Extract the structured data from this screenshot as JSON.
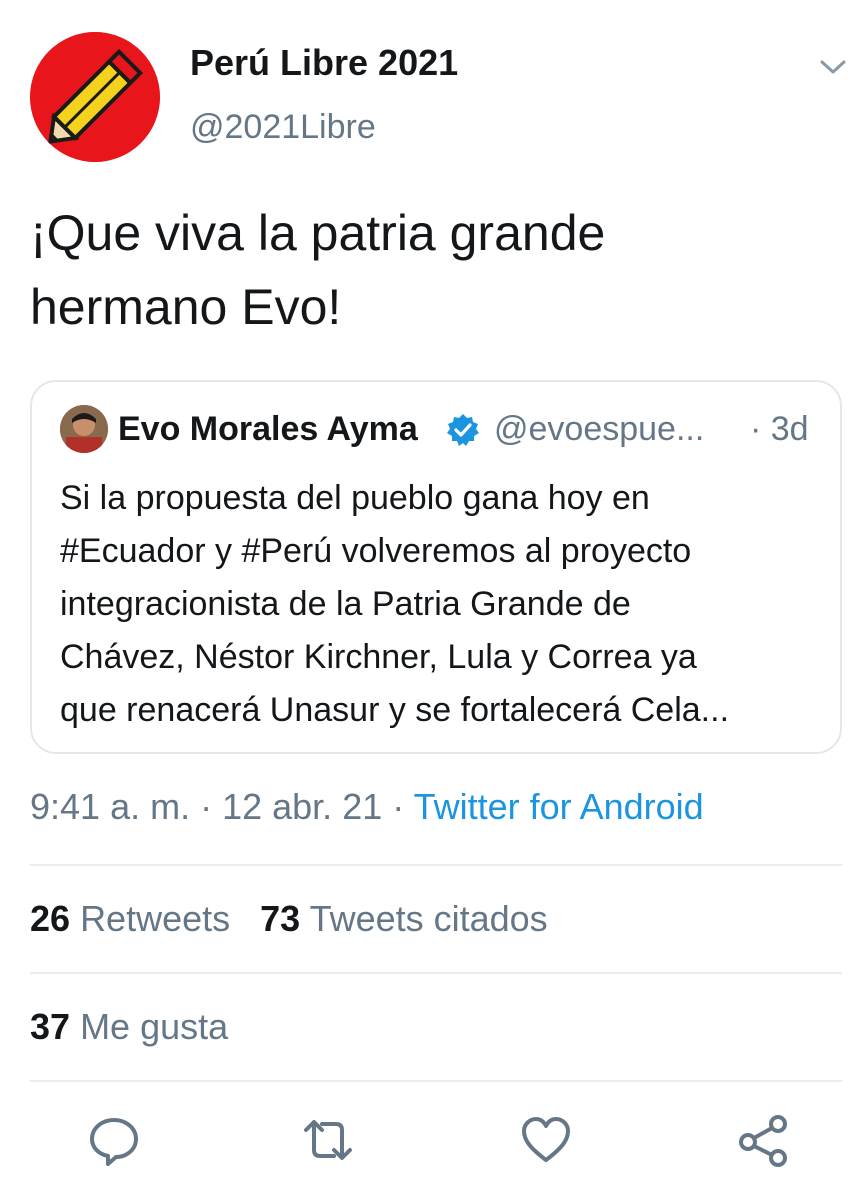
{
  "header": {
    "display_name": "Perú Libre 2021",
    "handle": "@2021Libre"
  },
  "tweet": {
    "text_lines": [
      "¡Que viva la patria grande",
      "hermano Evo!"
    ]
  },
  "quoted_tweet": {
    "name": "Evo Morales Ayma",
    "handle": "@evoespue...",
    "time": "· 3d",
    "text_lines": [
      "Si la propuesta del pueblo gana hoy en",
      "#Ecuador y #Perú volveremos al proyecto",
      "integracionista de la Patria Grande de",
      "Chávez, Néstor Kirchner, Lula y Correa ya",
      "que renacerá Unasur y se fortalecerá Cela..."
    ]
  },
  "meta": {
    "time": "9:41 a. m.",
    "sep1": " · ",
    "date": "12 abr. 21",
    "sep2": " · ",
    "source": "Twitter for Android"
  },
  "stats": {
    "retweets_count": "26",
    "retweets_label": "Retweets",
    "quotes_count": "73",
    "quotes_label": "Tweets citados",
    "likes_count": "37",
    "likes_label": "Me gusta"
  },
  "icons": {
    "caret": "chevron-down-icon",
    "reply": "reply-icon",
    "retweet": "retweet-icon",
    "like": "heart-icon",
    "share": "share-icon",
    "verified": "verified-badge-icon"
  },
  "colors": {
    "accent": "#1b95e0",
    "secondary_text": "#657786",
    "avatar_red": "#e8161b",
    "pencil_yellow": "#f5d31c"
  }
}
